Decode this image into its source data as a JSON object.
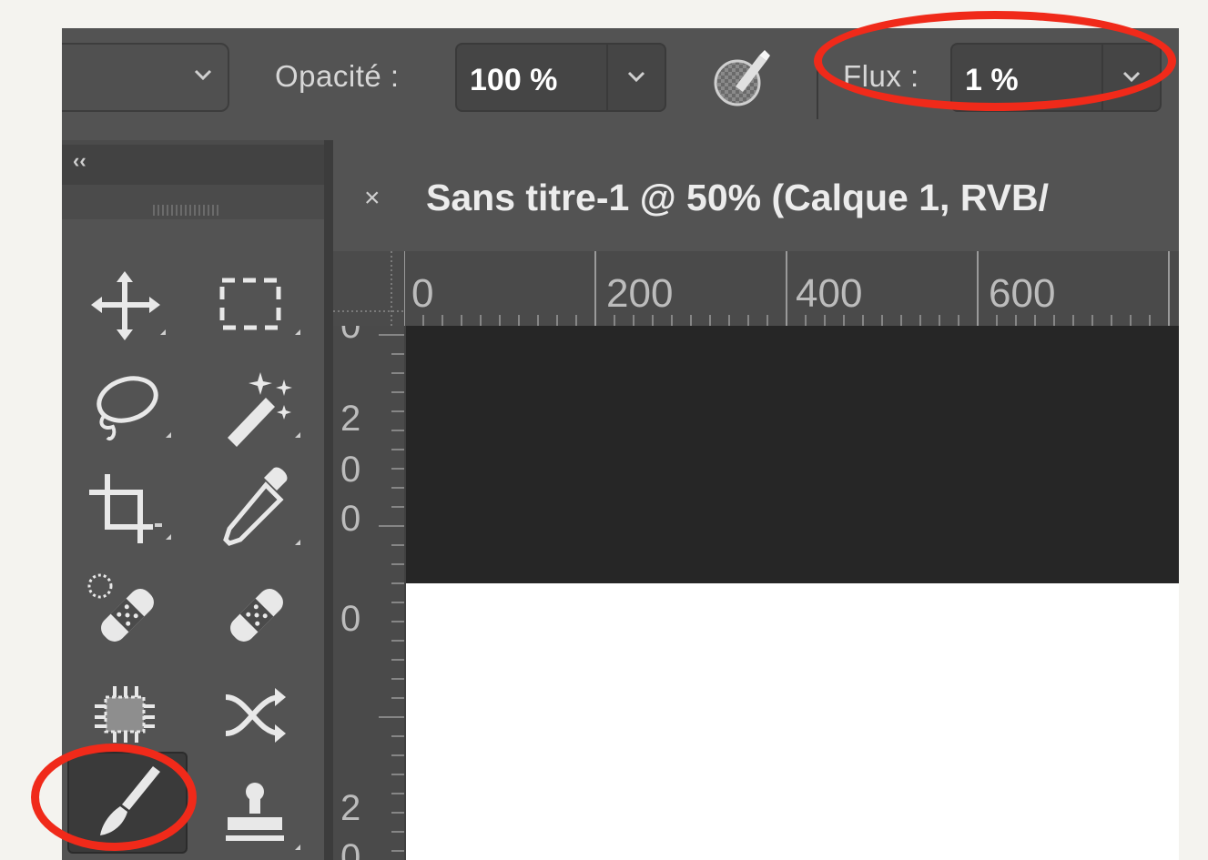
{
  "options_bar": {
    "opacity_label": "Opacité :",
    "opacity_value": "100 %",
    "flow_label": "Flux :",
    "flow_value": "1 %",
    "airbrush_icon": "airbrush-icon"
  },
  "tool_panel": {
    "collapse_glyph": "‹‹",
    "active_tool": "brush-tool"
  },
  "document": {
    "close_glyph": "×",
    "tab_title": "Sans titre-1 @ 50% (Calque 1, RVB/",
    "ruler_h": [
      "0",
      "200",
      "400",
      "600"
    ],
    "ruler_v_digits": [
      "0",
      "2",
      "0",
      "0",
      "0",
      "2",
      "0"
    ]
  },
  "annotations": {
    "highlight_color": "#f02a1a"
  }
}
